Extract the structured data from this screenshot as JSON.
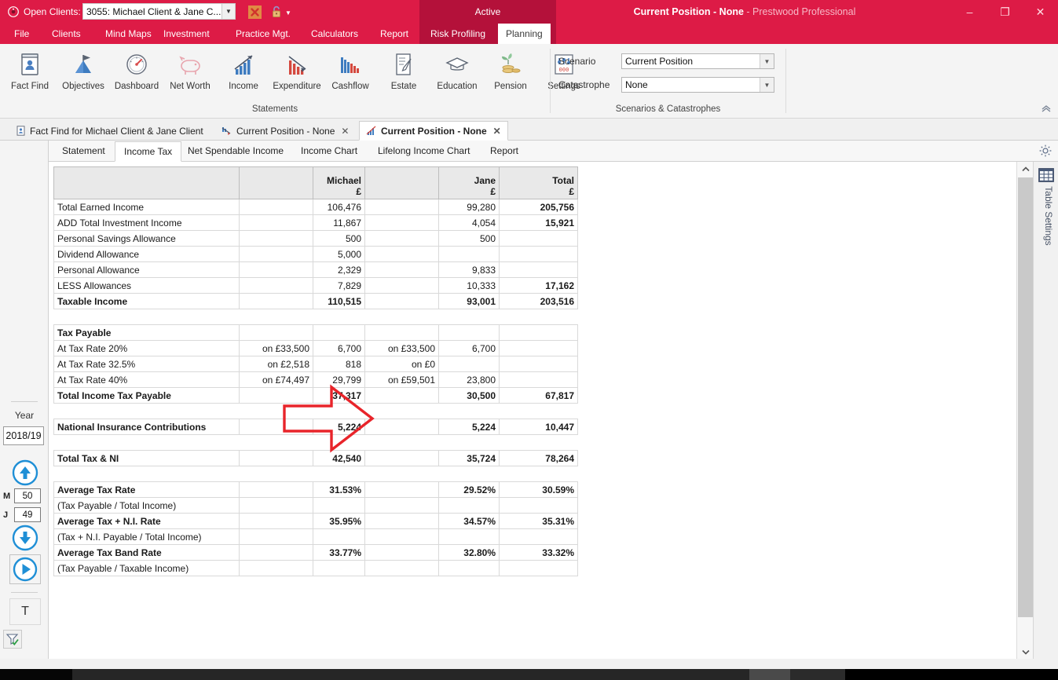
{
  "window": {
    "title_main": "Current Position - None",
    "title_sub": " - Prestwood Professional",
    "minimize": "–",
    "maximize": "❐",
    "close": "✕"
  },
  "titlebar": {
    "open_clients_label": "Open Clients:",
    "client_value": "3055: Michael Client & Jane C...",
    "active_label": "Active",
    "combo_arrow": "▼",
    "lock_arrow": "▼"
  },
  "menu": {
    "items": [
      {
        "label": "File"
      },
      {
        "label": "Clients"
      },
      {
        "label": "Mind Maps"
      },
      {
        "label": "Investment"
      },
      {
        "label": "Practice Mgt."
      },
      {
        "label": "Calculators"
      },
      {
        "label": "Report"
      },
      {
        "label": "Risk Profiling"
      },
      {
        "label": "Planning"
      }
    ],
    "active_index": 8
  },
  "ribbon": {
    "group_statements_title": "Statements",
    "group_scenarios_title": "Scenarios & Catastrophes",
    "collapse_glyph": "⌃",
    "buttons": [
      {
        "label": "Fact Find",
        "icon": "fact-find-icon"
      },
      {
        "label": "Objectives",
        "icon": "objectives-icon"
      },
      {
        "label": "Dashboard",
        "icon": "dashboard-icon"
      },
      {
        "label": "Net Worth",
        "icon": "net-worth-icon"
      },
      {
        "label": "Income",
        "icon": "income-icon"
      },
      {
        "label": "Expenditure",
        "icon": "expenditure-icon"
      },
      {
        "label": "Cashflow",
        "icon": "cashflow-icon"
      },
      {
        "label": "Estate",
        "icon": "estate-icon"
      },
      {
        "label": "Education",
        "icon": "education-icon"
      },
      {
        "label": "Pension",
        "icon": "pension-icon"
      },
      {
        "label": "Settings",
        "icon": "settings-icon"
      }
    ],
    "scenario_label": "Scenario",
    "scenario_value": "Current Position",
    "catastrophe_label": "Catastrophe",
    "catastrophe_value": "None",
    "combo_arrow": "▼"
  },
  "doc_tabs": [
    {
      "label": "Fact Find for Michael Client & Jane Client",
      "icon": "fact-find-tab-icon",
      "closable": false,
      "selected": false
    },
    {
      "label": "Current Position - None",
      "icon": "chart-down-tab-icon",
      "closable": true,
      "selected": false
    },
    {
      "label": "Current Position - None",
      "icon": "chart-up-tab-icon",
      "closable": true,
      "selected": true
    }
  ],
  "doc_tab_close_glyph": "✕",
  "sub_tabs": {
    "expand_glyph": "❯",
    "items": [
      {
        "label": "Statement",
        "selected": false
      },
      {
        "label": "Income Tax",
        "selected": true
      },
      {
        "label": "Net Spendable Income",
        "selected": false
      },
      {
        "label": "Income Chart",
        "selected": false
      },
      {
        "label": "Lifelong Income Chart",
        "selected": false
      },
      {
        "label": "Report",
        "selected": false
      }
    ]
  },
  "left_panel": {
    "year_label": "Year",
    "year_value": "2018/19",
    "up_icon": "arrow-up-circle-icon",
    "down_icon": "arrow-down-circle-icon",
    "play_icon": "play-circle-icon",
    "text_button_label": "T",
    "filter_icon": "filter-check-icon",
    "ages": [
      {
        "key": "M",
        "value": "50"
      },
      {
        "key": "J",
        "value": "49"
      }
    ]
  },
  "right_panel": {
    "label": "Table Settings",
    "icon": "table-grid-icon"
  },
  "scrollbar": {
    "up_glyph": "⌃",
    "down_glyph": "⌄"
  },
  "annotation": {
    "arrow_color": "#e8242a",
    "points_to_row": "Dividend Allowance"
  },
  "table": {
    "columns": [
      "",
      "",
      "Michael",
      "",
      "Jane",
      "Total"
    ],
    "currency_symbol": "£",
    "header": {
      "michael": "Michael",
      "jane": "Jane",
      "total": "Total",
      "currency": "£"
    },
    "rows": [
      {
        "type": "data",
        "bold": false,
        "muted": false,
        "label": "Total Earned Income",
        "c1": "",
        "michael": "106,476",
        "c3": "",
        "jane": "99,280",
        "total": "205,756",
        "total_bold": true
      },
      {
        "type": "data",
        "bold": false,
        "muted": false,
        "label": "ADD Total Investment Income",
        "c1": "",
        "michael": "11,867",
        "c3": "",
        "jane": "4,054",
        "total": "15,921",
        "total_bold": true
      },
      {
        "type": "data",
        "bold": false,
        "muted": false,
        "label": "Personal Savings Allowance",
        "c1": "",
        "michael": "500",
        "c3": "",
        "jane": "500",
        "total": "",
        "total_bold": false
      },
      {
        "type": "data",
        "bold": false,
        "muted": false,
        "label": "Dividend Allowance",
        "c1": "",
        "michael": "5,000",
        "c3": "",
        "jane": "",
        "total": "",
        "total_bold": false
      },
      {
        "type": "data",
        "bold": false,
        "muted": false,
        "label": "Personal Allowance",
        "c1": "",
        "michael": "2,329",
        "c3": "",
        "jane": "9,833",
        "total": "",
        "total_bold": false
      },
      {
        "type": "data",
        "bold": false,
        "muted": true,
        "label": "LESS Allowances",
        "c1": "",
        "michael": "7,829",
        "c3": "",
        "jane": "10,333",
        "total": "17,162",
        "total_bold": true
      },
      {
        "type": "data",
        "bold": true,
        "muted": false,
        "label": "Taxable Income",
        "c1": "",
        "michael": "110,515",
        "c3": "",
        "jane": "93,001",
        "total": "203,516",
        "total_bold": true
      },
      {
        "type": "gap"
      },
      {
        "type": "data",
        "bold": true,
        "muted": false,
        "label": "Tax Payable",
        "c1": "",
        "michael": "",
        "c3": "",
        "jane": "",
        "total": "",
        "total_bold": false
      },
      {
        "type": "data",
        "bold": false,
        "muted": false,
        "label": "At Tax Rate 20%",
        "c1": "on £33,500",
        "michael": "6,700",
        "c3": "on £33,500",
        "jane": "6,700",
        "total": "",
        "total_bold": false
      },
      {
        "type": "data",
        "bold": false,
        "muted": false,
        "label": "At Tax Rate 32.5%",
        "c1": "on £2,518",
        "michael": "818",
        "c3": "on £0",
        "jane": "",
        "total": "",
        "total_bold": false
      },
      {
        "type": "data",
        "bold": false,
        "muted": false,
        "label": "At Tax Rate 40%",
        "c1": "on £74,497",
        "michael": "29,799",
        "c3": "on £59,501",
        "jane": "23,800",
        "total": "",
        "total_bold": false
      },
      {
        "type": "data",
        "bold": true,
        "muted": false,
        "label": "Total Income Tax Payable",
        "c1": "",
        "michael": "37,317",
        "c3": "",
        "jane": "30,500",
        "total": "67,817",
        "total_bold": true
      },
      {
        "type": "gap"
      },
      {
        "type": "data",
        "bold": true,
        "muted": false,
        "label": "National Insurance Contributions",
        "c1": "",
        "michael": "5,224",
        "c3": "",
        "jane": "5,224",
        "total": "10,447",
        "total_bold": true
      },
      {
        "type": "gap"
      },
      {
        "type": "data",
        "bold": true,
        "muted": false,
        "label": "Total Tax & NI",
        "c1": "",
        "michael": "42,540",
        "c3": "",
        "jane": "35,724",
        "total": "78,264",
        "total_bold": true
      },
      {
        "type": "gap"
      },
      {
        "type": "data",
        "bold": true,
        "muted": false,
        "label": "Average Tax Rate",
        "c1": "",
        "michael": "31.53%",
        "c3": "",
        "jane": "29.52%",
        "total": "30.59%",
        "total_bold": true
      },
      {
        "type": "data",
        "bold": false,
        "muted": false,
        "label": "(Tax Payable / Total Income)",
        "c1": "",
        "michael": "",
        "c3": "",
        "jane": "",
        "total": "",
        "total_bold": false
      },
      {
        "type": "data",
        "bold": true,
        "muted": false,
        "label": "Average Tax + N.I. Rate",
        "c1": "",
        "michael": "35.95%",
        "c3": "",
        "jane": "34.57%",
        "total": "35.31%",
        "total_bold": true
      },
      {
        "type": "data",
        "bold": false,
        "muted": false,
        "label": "(Tax + N.I. Payable / Total Income)",
        "c1": "",
        "michael": "",
        "c3": "",
        "jane": "",
        "total": "",
        "total_bold": false
      },
      {
        "type": "data",
        "bold": true,
        "muted": false,
        "label": "Average Tax Band Rate",
        "c1": "",
        "michael": "33.77%",
        "c3": "",
        "jane": "32.80%",
        "total": "33.32%",
        "total_bold": true
      },
      {
        "type": "data",
        "bold": false,
        "muted": false,
        "label": "(Tax Payable / Taxable Income)",
        "c1": "",
        "michael": "",
        "c3": "",
        "jane": "",
        "total": "",
        "total_bold": false
      }
    ]
  },
  "colors": {
    "brand_red": "#dd1b46",
    "brand_red_dark": "#b4113a",
    "annotation_red": "#e8242a",
    "accent_blue": "#1f8fd6"
  }
}
